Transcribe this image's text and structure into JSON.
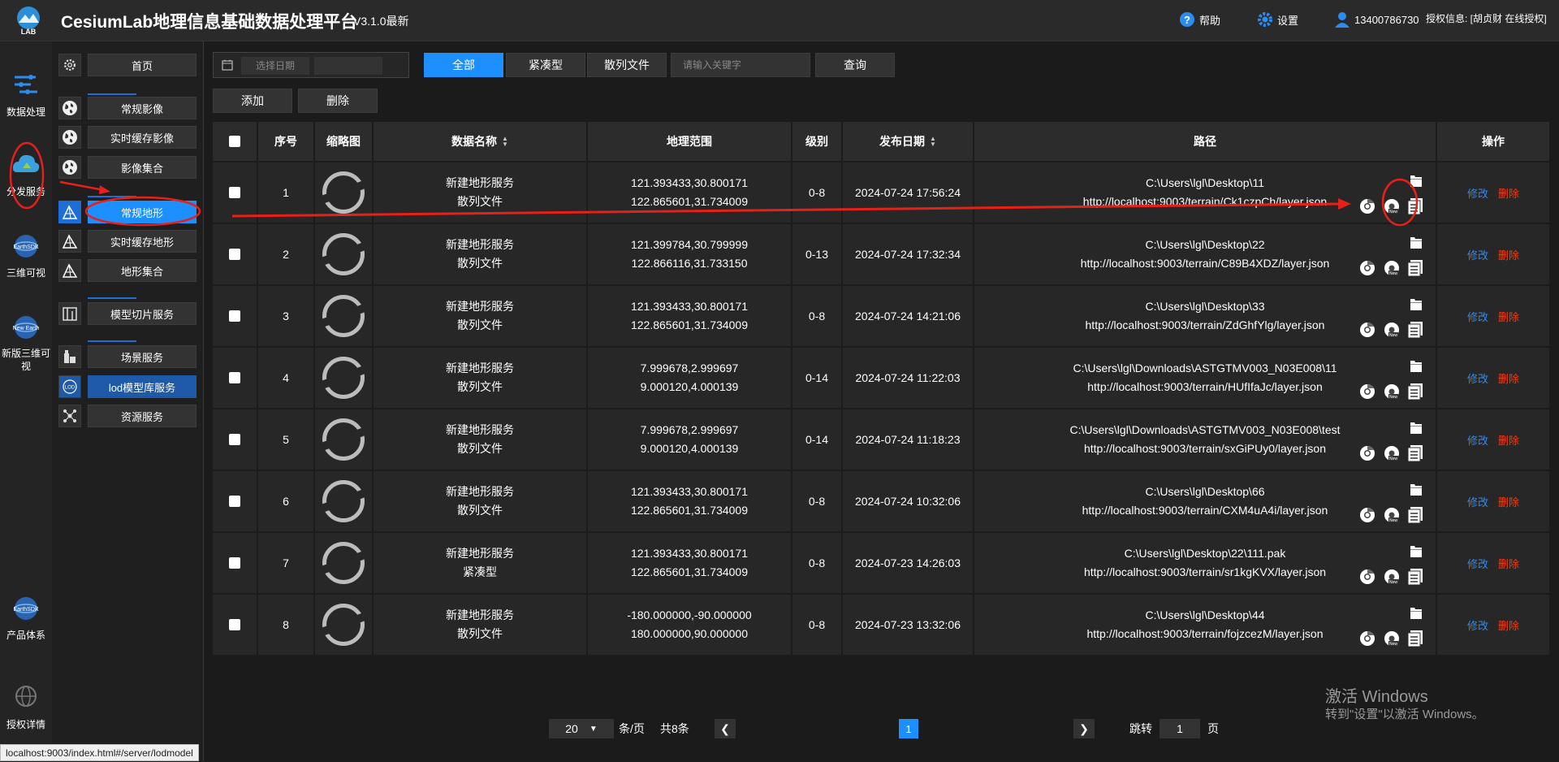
{
  "header": {
    "title": "CesiumLab地理信息基础数据处理平台",
    "version": "V3.1.0最新",
    "help": "帮助",
    "settings": "设置",
    "user": "13400786730",
    "license": "授权信息: [胡贞财 在线授权]"
  },
  "rail": {
    "items": [
      {
        "label": "数据处理",
        "icon": "data-process-icon"
      },
      {
        "label": "分发服务",
        "icon": "distribution-icon"
      },
      {
        "label": "三维可视",
        "icon": "earthsdk-icon"
      },
      {
        "label": "新版三维可视",
        "icon": "new-earth-icon"
      },
      {
        "label": "产品体系",
        "icon": "earthsdk-icon"
      },
      {
        "label": "授权详情",
        "icon": "globe-icon"
      }
    ]
  },
  "subnav": {
    "items": [
      {
        "label": "首页",
        "icon": "gear-icon"
      },
      {
        "label": "常规影像",
        "icon": "globe-icon"
      },
      {
        "label": "实时缓存影像",
        "icon": "globe-icon"
      },
      {
        "label": "影像集合",
        "icon": "globe-icon"
      },
      {
        "label": "常规地形",
        "icon": "terrain-icon",
        "active": true
      },
      {
        "label": "实时缓存地形",
        "icon": "terrain-icon"
      },
      {
        "label": "地形集合",
        "icon": "terrain-icon"
      },
      {
        "label": "模型切片服务",
        "icon": "model-tile-icon"
      },
      {
        "label": "场景服务",
        "icon": "building-icon"
      },
      {
        "label": "lod模型库服务",
        "icon": "lod-icon"
      },
      {
        "label": "资源服务",
        "icon": "share-icon"
      }
    ]
  },
  "toolbar": {
    "date_placeholder": "选择日期",
    "filters": [
      "全部",
      "紧凑型",
      "散列文件"
    ],
    "active_filter": "全部",
    "search_placeholder": "请输入关键字",
    "query": "查询",
    "add": "添加",
    "delete": "删除"
  },
  "table": {
    "headers": {
      "index": "序号",
      "thumb": "缩略图",
      "name": "数据名称",
      "extent": "地理范围",
      "level": "级别",
      "date": "发布日期",
      "path": "路径",
      "ops": "操作"
    },
    "edit_label": "修改",
    "delete_label": "删除",
    "rows": [
      {
        "index": "1",
        "name": "新建地形服务",
        "type": "散列文件",
        "ext1": "121.393433,30.800171",
        "ext2": "122.865601,31.734009",
        "level": "0-8",
        "date": "2024-07-24 17:56:24",
        "path": "C:\\Users\\lgl\\Desktop\\11",
        "url": "http://localhost:9003/terrain/Ck1czpCh/layer.json"
      },
      {
        "index": "2",
        "name": "新建地形服务",
        "type": "散列文件",
        "ext1": "121.399784,30.799999",
        "ext2": "122.866116,31.733150",
        "level": "0-13",
        "date": "2024-07-24 17:32:34",
        "path": "C:\\Users\\lgl\\Desktop\\22",
        "url": "http://localhost:9003/terrain/C89B4XDZ/layer.json"
      },
      {
        "index": "3",
        "name": "新建地形服务",
        "type": "散列文件",
        "ext1": "121.393433,30.800171",
        "ext2": "122.865601,31.734009",
        "level": "0-8",
        "date": "2024-07-24 14:21:06",
        "path": "C:\\Users\\lgl\\Desktop\\33",
        "url": "http://localhost:9003/terrain/ZdGhfYlg/layer.json"
      },
      {
        "index": "4",
        "name": "新建地形服务",
        "type": "散列文件",
        "ext1": "7.999678,2.999697",
        "ext2": "9.000120,4.000139",
        "level": "0-14",
        "date": "2024-07-24 11:22:03",
        "path": "C:\\Users\\lgl\\Downloads\\ASTGTMV003_N03E008\\11",
        "url": "http://localhost:9003/terrain/HUfIfaJc/layer.json"
      },
      {
        "index": "5",
        "name": "新建地形服务",
        "type": "散列文件",
        "ext1": "7.999678,2.999697",
        "ext2": "9.000120,4.000139",
        "level": "0-14",
        "date": "2024-07-24 11:18:23",
        "path": "C:\\Users\\lgl\\Downloads\\ASTGTMV003_N03E008\\test",
        "url": "http://localhost:9003/terrain/sxGiPUy0/layer.json"
      },
      {
        "index": "6",
        "name": "新建地形服务",
        "type": "散列文件",
        "ext1": "121.393433,30.800171",
        "ext2": "122.865601,31.734009",
        "level": "0-8",
        "date": "2024-07-24 10:32:06",
        "path": "C:\\Users\\lgl\\Desktop\\66",
        "url": "http://localhost:9003/terrain/CXM4uA4i/layer.json"
      },
      {
        "index": "7",
        "name": "新建地形服务",
        "type": "紧凑型",
        "ext1": "121.393433,30.800171",
        "ext2": "122.865601,31.734009",
        "level": "0-8",
        "date": "2024-07-23 14:26:03",
        "path": "C:\\Users\\lgl\\Desktop\\22\\111.pak",
        "url": "http://localhost:9003/terrain/sr1kgKVX/layer.json"
      },
      {
        "index": "8",
        "name": "新建地形服务",
        "type": "散列文件",
        "ext1": "-180.000000,-90.000000",
        "ext2": "180.000000,90.000000",
        "level": "0-8",
        "date": "2024-07-23 13:32:06",
        "path": "C:\\Users\\lgl\\Desktop\\44",
        "url": "http://localhost:9003/terrain/fojzcezM/layer.json"
      }
    ]
  },
  "pager": {
    "page_size": "20",
    "per_page_label": "条/页",
    "total": "共8条",
    "current": "1",
    "jump_label": "跳转",
    "jump_value": "1",
    "page_unit": "页"
  },
  "watermark": {
    "line1": "激活 Windows",
    "line2": "转到\"设置\"以激活 Windows。"
  },
  "status_url": "localhost:9003/index.html#/server/lodmodel",
  "colors": {
    "accent": "#1e8fff",
    "delete": "#ed4014",
    "edit": "#2d8cf0",
    "annotation": "#e8201a"
  }
}
